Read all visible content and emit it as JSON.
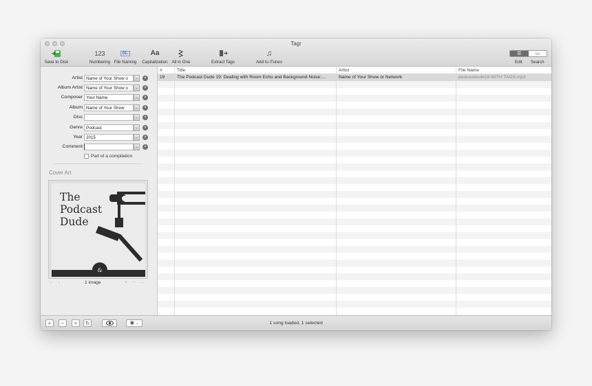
{
  "window": {
    "title": "Tagr"
  },
  "toolbar": {
    "items": [
      {
        "label": "Save to Disk",
        "icon": "save-to-disk-icon"
      },
      {
        "label": "Numbering",
        "icon": "numbering-icon",
        "glyph": "123"
      },
      {
        "label": "File Naming",
        "icon": "file-naming-icon",
        "glyph": "01-"
      },
      {
        "label": "Capitalization",
        "icon": "capitalization-icon",
        "glyph": "Aa"
      },
      {
        "label": "All in One",
        "icon": "all-in-one-icon"
      },
      {
        "label": "Extract Tags",
        "icon": "extract-tags-icon"
      },
      {
        "label": "Add to iTunes",
        "icon": "add-to-itunes-icon",
        "glyph": "♫"
      }
    ],
    "view_modes": [
      {
        "label": "Edit",
        "selected": true,
        "icon": "list-view-icon"
      },
      {
        "label": "Search",
        "selected": false,
        "icon": "search-view-icon"
      }
    ]
  },
  "tags": {
    "fields": [
      {
        "label": "Artist",
        "value": "Name of Your Show o"
      },
      {
        "label": "Album Artist",
        "value": "Name of Your Show o"
      },
      {
        "label": "Composer",
        "value": "Your Name"
      },
      {
        "label": "Album",
        "value": "Name of Your Show"
      },
      {
        "label": "Disc",
        "value": ""
      },
      {
        "label": "Genre",
        "value": "Podcast"
      },
      {
        "label": "Year",
        "value": "2015"
      },
      {
        "label": "Comment",
        "value": ""
      }
    ],
    "compilation_label": "Part of a compilation",
    "compilation_checked": false
  },
  "cover_art": {
    "section_title": "Cover Art",
    "artwork_text": [
      "The",
      "Podcast",
      "Dude"
    ],
    "image_count": "1 image",
    "nav_prev": "‹",
    "nav_next": "›",
    "add": "+",
    "remove": "−",
    "export": "→"
  },
  "table": {
    "columns": [
      "#",
      "Title",
      "Artist",
      "File Name"
    ],
    "rows": [
      {
        "number": "19",
        "title": "The Podcast Dude 19: Dealing with Room Echo and Background Noise:...",
        "artist": "Name of Your Show or Network",
        "file_name": "podcastdude19 WITH TAGS.mp3",
        "selected": true
      }
    ]
  },
  "bottom": {
    "buttons": [
      {
        "glyph": "+",
        "icon": "add-icon"
      },
      {
        "glyph": "−",
        "icon": "remove-icon"
      },
      {
        "glyph": "×",
        "icon": "clear-icon"
      },
      {
        "glyph": "↻",
        "icon": "reload-icon"
      }
    ],
    "preview_icon": "eye-icon",
    "settings_icon": "gear-icon",
    "status": "1 song loaded, 1 selected"
  }
}
